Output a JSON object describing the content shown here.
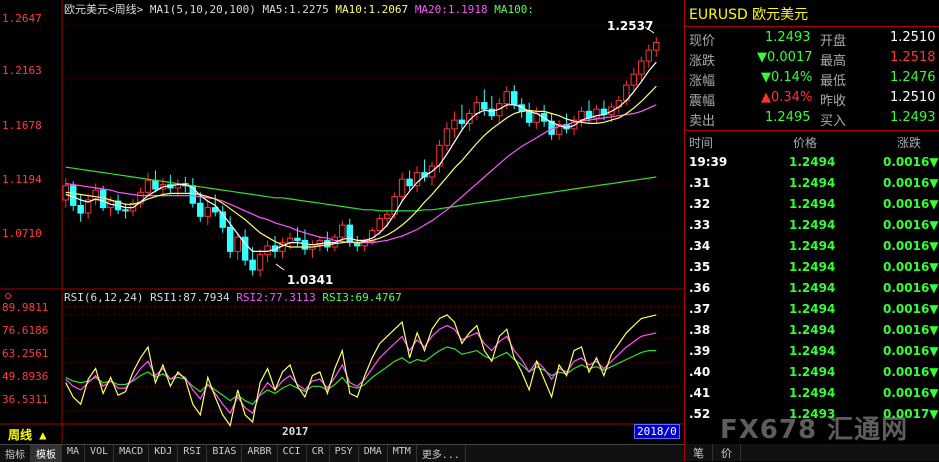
{
  "chart_header": {
    "title": "欧元美元<周线>",
    "ma_setting": "MA1(5,10,20,100)",
    "ma5": "MA5:1.2275",
    "ma10": "MA10:1.2067",
    "ma20": "MA20:1.1918",
    "ma100": "MA100:"
  },
  "rsi_header": {
    "setting": "RSI(6,12,24)",
    "rsi1": "RSI1:87.7934",
    "rsi2": "RSI2:77.3113",
    "rsi3": "RSI3:69.4767"
  },
  "price_axis": [
    "1.2647",
    "1.2163",
    "1.1678",
    "1.1194",
    "1.0710"
  ],
  "rsi_axis": [
    "89.9811",
    "76.6186",
    "63.2561",
    "49.8936",
    "36.5311"
  ],
  "annotations": {
    "high": "1.2537",
    "low": "1.0341"
  },
  "x_labels": {
    "year_2017": "2017",
    "current_date": "2018/0"
  },
  "period_label": "周线 ▲",
  "bottom_tabs": [
    "指标",
    "模板",
    "MA",
    "VOL",
    "MACD",
    "KDJ",
    "RSI",
    "BIAS",
    "ARBR",
    "CCI",
    "CR",
    "PSY",
    "DMA",
    "MTM",
    "更多..."
  ],
  "quote": {
    "title": "EURUSD 欧元美元",
    "rows": [
      {
        "l1": "现价",
        "v1": "1.2493",
        "c1": "green",
        "l2": "开盘",
        "v2": "1.2510",
        "c2": "white"
      },
      {
        "l1": "涨跌",
        "v1": "▼0.0017",
        "c1": "green",
        "l2": "最高",
        "v2": "1.2518",
        "c2": "red"
      },
      {
        "l1": "涨幅",
        "v1": "▼0.14%",
        "c1": "green",
        "l2": "最低",
        "v2": "1.2476",
        "c2": "green"
      },
      {
        "l1": "震幅",
        "v1": "▲0.34%",
        "c1": "red",
        "l2": "昨收",
        "v2": "1.2510",
        "c2": "white"
      },
      {
        "l1": "卖出",
        "v1": "1.2495",
        "c1": "green",
        "l2": "买入",
        "v2": "1.2493",
        "c2": "green"
      }
    ],
    "tick_header": {
      "time": "时间",
      "price": "价格",
      "change": "涨跌"
    },
    "ticks": [
      {
        "time": "19:39",
        "price": "1.2494",
        "change": "0.0016▼"
      },
      {
        "time": ".31",
        "price": "1.2494",
        "change": "0.0016▼"
      },
      {
        "time": ".32",
        "price": "1.2494",
        "change": "0.0016▼"
      },
      {
        "time": ".33",
        "price": "1.2494",
        "change": "0.0016▼"
      },
      {
        "time": ".34",
        "price": "1.2494",
        "change": "0.0016▼"
      },
      {
        "time": ".35",
        "price": "1.2494",
        "change": "0.0016▼"
      },
      {
        "time": ".36",
        "price": "1.2494",
        "change": "0.0016▼"
      },
      {
        "time": ".37",
        "price": "1.2494",
        "change": "0.0016▼"
      },
      {
        "time": ".38",
        "price": "1.2494",
        "change": "0.0016▼"
      },
      {
        "time": ".39",
        "price": "1.2494",
        "change": "0.0016▼"
      },
      {
        "time": ".40",
        "price": "1.2494",
        "change": "0.0016▼"
      },
      {
        "time": ".41",
        "price": "1.2494",
        "change": "0.0016▼"
      },
      {
        "time": ".52",
        "price": "1.2493",
        "change": "0.0017▼"
      }
    ],
    "bottom_tabs": [
      "笔",
      "价"
    ]
  },
  "watermark": "FX678 汇通网",
  "colors": {
    "up": "#ff3333",
    "down": "#33ffff",
    "ma5": "#ffffff",
    "ma10": "#ffff66",
    "ma20": "#ff55ff",
    "ma100": "#33dd33"
  },
  "chart_data": {
    "type": "candlestick",
    "price_range": [
      1.03,
      1.275
    ],
    "rsi_range": [
      30,
      95
    ],
    "candles": [
      [
        1.105,
        1.125,
        1.098,
        1.118
      ],
      [
        1.118,
        1.122,
        1.095,
        1.1
      ],
      [
        1.1,
        1.11,
        1.085,
        1.093
      ],
      [
        1.093,
        1.11,
        1.088,
        1.105
      ],
      [
        1.105,
        1.12,
        1.1,
        1.114
      ],
      [
        1.114,
        1.118,
        1.095,
        1.098
      ],
      [
        1.098,
        1.108,
        1.09,
        1.104
      ],
      [
        1.104,
        1.11,
        1.092,
        1.096
      ],
      [
        1.096,
        1.102,
        1.088,
        1.095
      ],
      [
        1.095,
        1.106,
        1.09,
        1.102
      ],
      [
        1.102,
        1.116,
        1.098,
        1.112
      ],
      [
        1.112,
        1.13,
        1.108,
        1.123
      ],
      [
        1.123,
        1.132,
        1.112,
        1.115
      ],
      [
        1.115,
        1.125,
        1.108,
        1.119
      ],
      [
        1.119,
        1.128,
        1.11,
        1.116
      ],
      [
        1.116,
        1.124,
        1.108,
        1.12
      ],
      [
        1.12,
        1.126,
        1.112,
        1.118
      ],
      [
        1.118,
        1.125,
        1.098,
        1.102
      ],
      [
        1.102,
        1.112,
        1.085,
        1.09
      ],
      [
        1.09,
        1.105,
        1.082,
        1.098
      ],
      [
        1.098,
        1.11,
        1.09,
        1.094
      ],
      [
        1.094,
        1.1,
        1.075,
        1.08
      ],
      [
        1.08,
        1.09,
        1.052,
        1.058
      ],
      [
        1.058,
        1.075,
        1.05,
        1.071
      ],
      [
        1.071,
        1.078,
        1.045,
        1.05
      ],
      [
        1.05,
        1.062,
        1.036,
        1.041
      ],
      [
        1.041,
        1.06,
        1.035,
        1.055
      ],
      [
        1.055,
        1.068,
        1.048,
        1.063
      ],
      [
        1.063,
        1.072,
        1.052,
        1.058
      ],
      [
        1.058,
        1.07,
        1.052,
        1.066
      ],
      [
        1.066,
        1.075,
        1.06,
        1.07
      ],
      [
        1.07,
        1.08,
        1.062,
        1.068
      ],
      [
        1.068,
        1.078,
        1.055,
        1.06
      ],
      [
        1.06,
        1.068,
        1.052,
        1.064
      ],
      [
        1.064,
        1.072,
        1.058,
        1.068
      ],
      [
        1.068,
        1.076,
        1.058,
        1.062
      ],
      [
        1.062,
        1.074,
        1.058,
        1.071
      ],
      [
        1.071,
        1.086,
        1.066,
        1.082
      ],
      [
        1.082,
        1.088,
        1.062,
        1.066
      ],
      [
        1.066,
        1.072,
        1.058,
        1.063
      ],
      [
        1.063,
        1.07,
        1.058,
        1.067
      ],
      [
        1.067,
        1.08,
        1.064,
        1.077
      ],
      [
        1.077,
        1.092,
        1.073,
        1.088
      ],
      [
        1.088,
        1.096,
        1.08,
        1.092
      ],
      [
        1.092,
        1.112,
        1.088,
        1.108
      ],
      [
        1.108,
        1.13,
        1.104,
        1.124
      ],
      [
        1.124,
        1.132,
        1.114,
        1.118
      ],
      [
        1.118,
        1.136,
        1.112,
        1.13
      ],
      [
        1.13,
        1.142,
        1.122,
        1.126
      ],
      [
        1.126,
        1.14,
        1.118,
        1.136
      ],
      [
        1.136,
        1.16,
        1.13,
        1.155
      ],
      [
        1.155,
        1.176,
        1.15,
        1.17
      ],
      [
        1.17,
        1.186,
        1.162,
        1.178
      ],
      [
        1.178,
        1.192,
        1.17,
        1.175
      ],
      [
        1.175,
        1.188,
        1.168,
        1.184
      ],
      [
        1.184,
        1.2,
        1.178,
        1.194
      ],
      [
        1.194,
        1.206,
        1.182,
        1.188
      ],
      [
        1.188,
        1.2,
        1.178,
        1.182
      ],
      [
        1.182,
        1.198,
        1.175,
        1.193
      ],
      [
        1.193,
        1.209,
        1.188,
        1.204
      ],
      [
        1.204,
        1.21,
        1.188,
        1.192
      ],
      [
        1.192,
        1.198,
        1.18,
        1.186
      ],
      [
        1.186,
        1.194,
        1.172,
        1.176
      ],
      [
        1.176,
        1.19,
        1.17,
        1.184
      ],
      [
        1.184,
        1.192,
        1.172,
        1.177
      ],
      [
        1.177,
        1.184,
        1.16,
        1.165
      ],
      [
        1.165,
        1.178,
        1.16,
        1.174
      ],
      [
        1.174,
        1.184,
        1.166,
        1.17
      ],
      [
        1.17,
        1.182,
        1.164,
        1.178
      ],
      [
        1.178,
        1.19,
        1.172,
        1.186
      ],
      [
        1.186,
        1.196,
        1.176,
        1.18
      ],
      [
        1.18,
        1.192,
        1.175,
        1.188
      ],
      [
        1.188,
        1.196,
        1.178,
        1.183
      ],
      [
        1.183,
        1.194,
        1.176,
        1.19
      ],
      [
        1.19,
        1.2,
        1.184,
        1.196
      ],
      [
        1.196,
        1.214,
        1.192,
        1.21
      ],
      [
        1.21,
        1.226,
        1.204,
        1.22
      ],
      [
        1.22,
        1.236,
        1.214,
        1.232
      ],
      [
        1.232,
        1.247,
        1.226,
        1.242
      ],
      [
        1.242,
        1.254,
        1.236,
        1.249
      ]
    ],
    "ma5": [
      1.11,
      1.108,
      1.105,
      1.103,
      1.106,
      1.104,
      1.101,
      1.1,
      1.098,
      1.098,
      1.103,
      1.109,
      1.113,
      1.117,
      1.118,
      1.119,
      1.119,
      1.116,
      1.109,
      1.104,
      1.1,
      1.092,
      1.083,
      1.074,
      1.065,
      1.058,
      1.058,
      1.058,
      1.06,
      1.063,
      1.066,
      1.066,
      1.065,
      1.064,
      1.065,
      1.066,
      1.066,
      1.069,
      1.07,
      1.068,
      1.068,
      1.07,
      1.075,
      1.082,
      1.092,
      1.104,
      1.113,
      1.121,
      1.127,
      1.131,
      1.137,
      1.147,
      1.158,
      1.169,
      1.178,
      1.184,
      1.187,
      1.186,
      1.188,
      1.192,
      1.192,
      1.19,
      1.186,
      1.184,
      1.18,
      1.176,
      1.173,
      1.171,
      1.173,
      1.178,
      1.18,
      1.182,
      1.183,
      1.186,
      1.19,
      1.196,
      1.204,
      1.213,
      1.223,
      1.231
    ],
    "ma10": [
      1.112,
      1.111,
      1.11,
      1.109,
      1.108,
      1.107,
      1.105,
      1.103,
      1.101,
      1.101,
      1.103,
      1.106,
      1.108,
      1.11,
      1.111,
      1.111,
      1.111,
      1.111,
      1.11,
      1.108,
      1.106,
      1.102,
      1.097,
      1.092,
      1.087,
      1.081,
      1.075,
      1.071,
      1.067,
      1.064,
      1.062,
      1.062,
      1.062,
      1.062,
      1.063,
      1.064,
      1.065,
      1.066,
      1.067,
      1.066,
      1.067,
      1.068,
      1.07,
      1.073,
      1.077,
      1.082,
      1.088,
      1.095,
      1.103,
      1.11,
      1.118,
      1.126,
      1.134,
      1.141,
      1.149,
      1.157,
      1.164,
      1.17,
      1.175,
      1.18,
      1.184,
      1.186,
      1.187,
      1.186,
      1.186,
      1.184,
      1.182,
      1.179,
      1.177,
      1.176,
      1.175,
      1.175,
      1.176,
      1.178,
      1.18,
      1.184,
      1.189,
      1.195,
      1.202,
      1.209
    ],
    "ma20": [
      1.12,
      1.119,
      1.118,
      1.117,
      1.116,
      1.115,
      1.114,
      1.112,
      1.111,
      1.11,
      1.109,
      1.109,
      1.109,
      1.109,
      1.109,
      1.109,
      1.109,
      1.109,
      1.108,
      1.107,
      1.106,
      1.104,
      1.101,
      1.098,
      1.095,
      1.092,
      1.089,
      1.087,
      1.084,
      1.082,
      1.08,
      1.077,
      1.075,
      1.073,
      1.071,
      1.07,
      1.068,
      1.067,
      1.066,
      1.066,
      1.066,
      1.066,
      1.067,
      1.068,
      1.07,
      1.072,
      1.075,
      1.078,
      1.082,
      1.086,
      1.091,
      1.096,
      1.102,
      1.108,
      1.114,
      1.12,
      1.126,
      1.132,
      1.138,
      1.144,
      1.149,
      1.154,
      1.158,
      1.162,
      1.166,
      1.17,
      1.172,
      1.174,
      1.176,
      1.177,
      1.178,
      1.179,
      1.18,
      1.181,
      1.182,
      1.183,
      1.184,
      1.186,
      1.189,
      1.192
    ],
    "ma100": [
      1.135,
      1.134,
      1.133,
      1.132,
      1.131,
      1.13,
      1.129,
      1.128,
      1.127,
      1.126,
      1.125,
      1.124,
      1.123,
      1.122,
      1.121,
      1.12,
      1.119,
      1.118,
      1.117,
      1.116,
      1.115,
      1.114,
      1.113,
      1.112,
      1.111,
      1.11,
      1.109,
      1.108,
      1.107,
      1.107,
      1.106,
      1.105,
      1.104,
      1.103,
      1.102,
      1.101,
      1.1,
      1.099,
      1.098,
      1.097,
      1.096,
      1.096,
      1.095,
      1.095,
      1.095,
      1.095,
      1.095,
      1.095,
      1.096,
      1.096,
      1.097,
      1.098,
      1.099,
      1.1,
      1.101,
      1.102,
      1.103,
      1.104,
      1.105,
      1.106,
      1.107,
      1.108,
      1.109,
      1.11,
      1.111,
      1.112,
      1.113,
      1.114,
      1.115,
      1.116,
      1.117,
      1.118,
      1.119,
      1.12,
      1.121,
      1.122,
      1.123,
      1.124,
      1.125,
      1.126
    ],
    "rsi1": [
      52,
      44,
      40,
      54,
      60,
      46,
      55,
      45,
      47,
      58,
      66,
      72,
      52,
      62,
      50,
      58,
      54,
      40,
      34,
      55,
      44,
      34,
      28,
      48,
      34,
      30,
      52,
      60,
      48,
      58,
      62,
      50,
      44,
      56,
      58,
      46,
      60,
      70,
      46,
      44,
      56,
      66,
      74,
      78,
      82,
      86,
      66,
      80,
      70,
      82,
      88,
      90,
      86,
      74,
      80,
      84,
      70,
      64,
      78,
      82,
      66,
      58,
      48,
      64,
      54,
      44,
      62,
      56,
      70,
      72,
      58,
      66,
      56,
      68,
      74,
      80,
      84,
      88,
      89,
      90
    ],
    "rsi2": [
      54,
      50,
      48,
      52,
      56,
      50,
      53,
      49,
      49,
      54,
      60,
      64,
      56,
      60,
      54,
      57,
      55,
      48,
      43,
      51,
      46,
      40,
      35,
      44,
      38,
      35,
      46,
      52,
      48,
      53,
      56,
      51,
      48,
      53,
      54,
      49,
      55,
      62,
      52,
      50,
      54,
      60,
      66,
      70,
      74,
      78,
      70,
      76,
      72,
      78,
      82,
      84,
      82,
      76,
      78,
      80,
      74,
      70,
      75,
      78,
      70,
      65,
      58,
      64,
      60,
      54,
      60,
      58,
      64,
      66,
      62,
      64,
      60,
      64,
      68,
      72,
      75,
      78,
      79,
      80
    ],
    "rsi3": [
      55,
      53,
      52,
      53,
      55,
      52,
      53,
      51,
      51,
      53,
      56,
      58,
      55,
      57,
      54,
      55,
      54,
      50,
      47,
      51,
      48,
      45,
      42,
      45,
      42,
      40,
      45,
      48,
      46,
      49,
      51,
      49,
      47,
      50,
      50,
      48,
      51,
      55,
      50,
      49,
      51,
      55,
      58,
      61,
      64,
      66,
      63,
      65,
      64,
      67,
      70,
      72,
      71,
      68,
      69,
      70,
      67,
      65,
      67,
      69,
      65,
      62,
      58,
      61,
      59,
      56,
      58,
      57,
      60,
      62,
      60,
      61,
      59,
      61,
      63,
      65,
      67,
      69,
      70,
      70
    ]
  }
}
